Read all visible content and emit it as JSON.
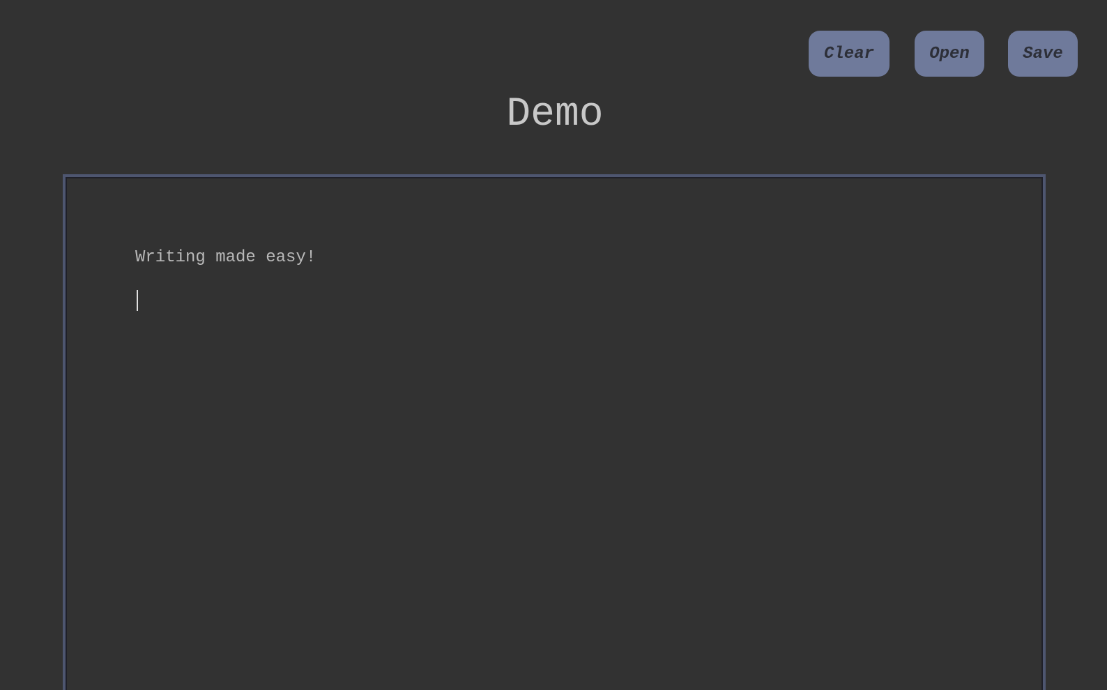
{
  "toolbar": {
    "clear_label": "Clear",
    "open_label": "Open",
    "save_label": "Save"
  },
  "page": {
    "title": "Demo"
  },
  "editor": {
    "content": "Writing made easy!"
  },
  "colors": {
    "background": "#323232",
    "button_bg": "#6f7a9b",
    "button_text": "#2d2f38",
    "editor_border": "#4e5670",
    "text": "#b9b9b9"
  }
}
